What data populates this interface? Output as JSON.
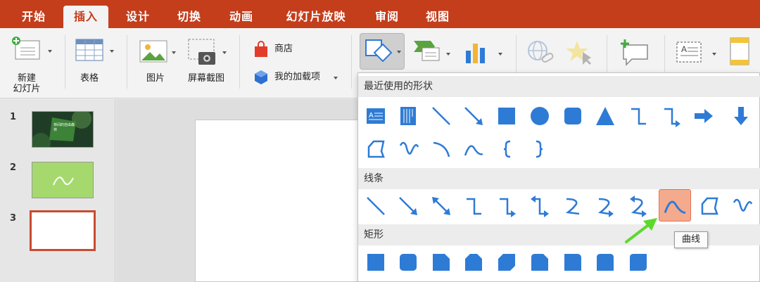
{
  "tabs": [
    "开始",
    "插入",
    "设计",
    "切换",
    "动画",
    "幻灯片放映",
    "审阅",
    "视图"
  ],
  "active_tab": "插入",
  "ribbon": {
    "new_slide_label_1": "新建",
    "new_slide_label_2": "幻灯片",
    "table_label": "表格",
    "picture_label": "图片",
    "screenshot_label": "屏幕截图",
    "store_label": "商店",
    "addins_label": "我的加载项"
  },
  "slides": {
    "numbers": [
      "1",
      "2",
      "3"
    ],
    "slide1_title": "林间的自由森林"
  },
  "dropdown": {
    "recent_header": "最近使用的形状",
    "lines_header": "线条",
    "rect_header": "矩形"
  },
  "tooltip": "曲线",
  "colors": {
    "tabbar": "#c43e1c",
    "shape_blue": "#2e7bd6",
    "highlight": "#f3aa8d",
    "arrow_green": "#5ed82c",
    "selected_slide_border": "#c84b31"
  },
  "icons": {
    "recent": [
      "text-box-icon",
      "vertical-text-box-icon",
      "line-icon",
      "arrow-line-icon",
      "rectangle-icon",
      "oval-icon",
      "rounded-rectangle-icon",
      "triangle-icon",
      "elbow-connector-icon",
      "elbow-arrow-connector-icon",
      "right-arrow-icon",
      "down-arrow-icon",
      "freeform-icon",
      "scribble-icon",
      "arc-icon",
      "curve-icon",
      "left-brace-icon",
      "right-brace-icon"
    ],
    "lines": [
      "line-icon",
      "arrow-line-icon",
      "double-arrow-line-icon",
      "elbow-connector-icon",
      "elbow-arrow-connector-icon",
      "elbow-double-arrow-connector-icon",
      "curved-connector-icon",
      "curved-arrow-connector-icon",
      "curved-double-arrow-connector-icon",
      "curve-icon",
      "freeform-icon",
      "scribble-icon"
    ],
    "rects": [
      "rectangle-icon",
      "rounded-rectangle-icon",
      "snip-single-corner-icon",
      "snip-same-side-icon",
      "snip-diagonal-icon",
      "snip-round-corner-icon",
      "round-single-corner-icon",
      "round-same-side-icon",
      "round-diagonal-icon"
    ]
  }
}
